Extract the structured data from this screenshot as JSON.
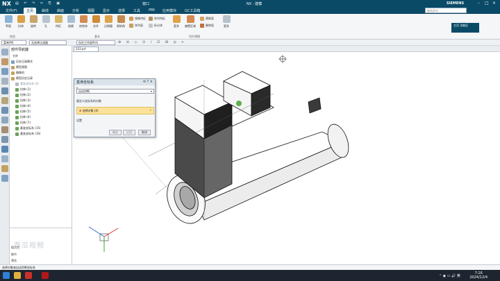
{
  "titlebar": {
    "logo": "NX",
    "title": "NX - 建模",
    "brand": "SIEMENS",
    "window_menu": "窗口"
  },
  "menu": [
    "文件(F)",
    "主页",
    "曲线",
    "曲面",
    "分析",
    "视图",
    "显示",
    "选择",
    "工具",
    "PMI",
    "应用模块",
    "GC工具箱"
  ],
  "search_placeholder": "查找命令",
  "ribbon": {
    "buttons": [
      "草图",
      "拉伸",
      "旋转",
      "孔",
      "特征",
      "拔模",
      "修剪体",
      "合并",
      "边倒圆",
      "倒斜角",
      "阵列特征",
      "拆分体",
      "抽壳",
      "替换面"
    ],
    "small_buttons": [
      "镜像特征",
      "阵列面",
      "修剪体",
      "拆分面",
      "偏置区域",
      "删除面",
      "更多"
    ],
    "groups": [
      "构造",
      "基本",
      "同步建模"
    ],
    "right_button": "主页 功能区"
  },
  "selbar": {
    "filter": "菜单(M)",
    "type": "无选择过滤器",
    "scope": "仅在工作部件内"
  },
  "navpanel": {
    "title": "部件导航器",
    "column": "名称",
    "tree": [
      {
        "label": "历史记录模式"
      },
      {
        "label": "模型视图"
      },
      {
        "label": "摄像机"
      },
      {
        "label": "模型历史记录"
      },
      {
        "label": "基准坐标系 (0)",
        "sel": true
      },
      {
        "label": "拉伸 (1)"
      },
      {
        "label": "拉伸 (2)"
      },
      {
        "label": "拉伸 (3)"
      },
      {
        "label": "拉伸 (4)"
      },
      {
        "label": "拉伸 (5)"
      },
      {
        "label": "拉伸 (6)"
      },
      {
        "label": "拉伸 (7)"
      },
      {
        "label": "基准坐标系 (15)"
      },
      {
        "label": "基准坐标系 (16)"
      }
    ],
    "accordions": [
      "相关性",
      "细节",
      "预览"
    ]
  },
  "tab": "333.prt",
  "dialog": {
    "title": "基准坐标系",
    "type": "自动判断",
    "ref_label": "要定义坐标系的对象",
    "select_label": "选择对象 (0)",
    "settings": "设置",
    "ok": "确定",
    "apply": "应用",
    "cancel": "取消"
  },
  "statusbar": "选择对象来自动判断坐标系",
  "taskbar": {
    "time": "7:16",
    "date": "2024/12/4",
    "lang": "英"
  },
  "watermark": "西瓜视频"
}
